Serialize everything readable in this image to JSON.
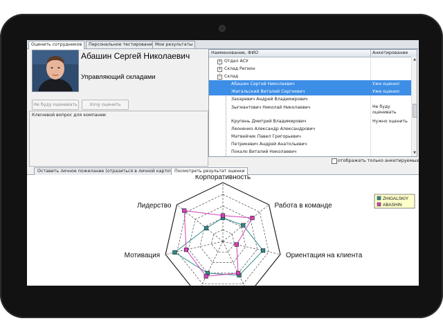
{
  "tabs_top": [
    "Оценить сотрудников",
    "Персональное тестирование",
    "Мои результаты"
  ],
  "employee": {
    "name": "Абашин Сергей Николаевич",
    "position": "Управляющий складами"
  },
  "buttons": {
    "no_rate": "Не буду оценивать",
    "want_rate": "Хочу оценить"
  },
  "key_question_label": "Ключевой вопрос для компании",
  "grid": {
    "col_name": "Наименование, ФИО",
    "col_ank": "Анкетирование",
    "rows": [
      {
        "name": "Отдел АСУ",
        "ank": ""
      },
      {
        "name": "Склад Регион",
        "ank": ""
      },
      {
        "name": "Склад",
        "ank": ""
      },
      {
        "name": "Абашин Сергей Николаевич",
        "ank": "Уже оценил"
      },
      {
        "name": "Жигальский Виталий Сергеевич",
        "ank": "Уже оценил"
      },
      {
        "name": "Захаревич Андрей Владимирович",
        "ank": ""
      },
      {
        "name": "Зыгмантович Николай Николаевич",
        "ank": "Не буду оценивать"
      },
      {
        "name": "Крупень Дмитрий Владимирович",
        "ank": "Нужно оценить"
      },
      {
        "name": "Леоненко Александр Александрович",
        "ank": ""
      },
      {
        "name": "Матвейчик Павел Григорьевич",
        "ank": ""
      },
      {
        "name": "Петрикевич Андрей Анатольевич",
        "ank": ""
      },
      {
        "name": "Покало Виталий Николаевич",
        "ank": ""
      }
    ],
    "only_ank_label": "отображать только анкетируемых"
  },
  "tabs_bottom": [
    "Оставить личное пожелание (отразиться в личной карточке",
    "Посмотреть результат оценки"
  ],
  "colors": {
    "selection": "#3d8ee6",
    "series1": "#2e8b8b",
    "series2": "#d23fb8"
  },
  "chart_data": {
    "type": "radar",
    "axes": [
      "Корпоративность",
      "Работа в команде",
      "Ориентация на клиента",
      "",
      "",
      "Мотивация",
      "Лидерство"
    ],
    "rmax": 5,
    "rings": 5,
    "series": [
      {
        "name": "ZHIGALSKIY",
        "values": [
          2,
          2.2,
          3.5,
          3.2,
          3,
          4.2,
          1.8
        ]
      },
      {
        "name": "ABASHIN",
        "values": [
          2.2,
          3.2,
          1.2,
          3,
          3.3,
          3.2,
          4.2
        ]
      }
    ],
    "legend": "top-right"
  }
}
